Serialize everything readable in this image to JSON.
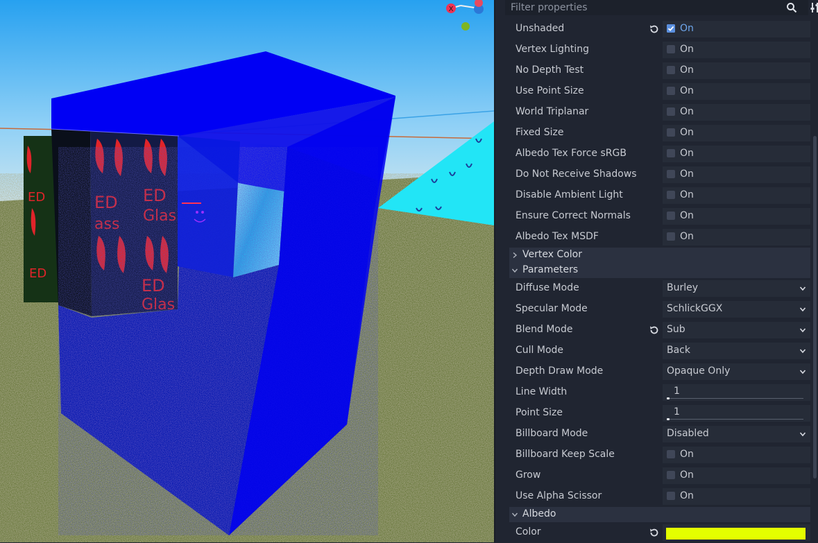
{
  "inspector": {
    "filter_placeholder": "Filter properties",
    "on_label": "On",
    "flags": [
      {
        "name": "Unshaded",
        "checked": true,
        "modified": true
      },
      {
        "name": "Vertex Lighting",
        "checked": false,
        "modified": false
      },
      {
        "name": "No Depth Test",
        "checked": false,
        "modified": false
      },
      {
        "name": "Use Point Size",
        "checked": false,
        "modified": false
      },
      {
        "name": "World Triplanar",
        "checked": false,
        "modified": false
      },
      {
        "name": "Fixed Size",
        "checked": false,
        "modified": false
      },
      {
        "name": "Albedo Tex Force sRGB",
        "checked": false,
        "modified": false
      },
      {
        "name": "Do Not Receive Shadows",
        "checked": false,
        "modified": false
      },
      {
        "name": "Disable Ambient Light",
        "checked": false,
        "modified": false
      },
      {
        "name": "Ensure Correct Normals",
        "checked": false,
        "modified": false
      },
      {
        "name": "Albedo Tex MSDF",
        "checked": false,
        "modified": false
      }
    ],
    "section_vertex_color": "Vertex Color",
    "section_parameters": "Parameters",
    "parameters": {
      "diffuse_mode": {
        "name": "Diffuse Mode",
        "value": "Burley"
      },
      "specular_mode": {
        "name": "Specular Mode",
        "value": "SchlickGGX"
      },
      "blend_mode": {
        "name": "Blend Mode",
        "value": "Sub",
        "modified": true
      },
      "cull_mode": {
        "name": "Cull Mode",
        "value": "Back"
      },
      "depth_draw_mode": {
        "name": "Depth Draw Mode",
        "value": "Opaque Only"
      },
      "line_width": {
        "name": "Line Width",
        "value": "1"
      },
      "point_size": {
        "name": "Point Size",
        "value": "1"
      },
      "billboard_mode": {
        "name": "Billboard Mode",
        "value": "Disabled"
      },
      "billboard_keep_scale": {
        "name": "Billboard Keep Scale",
        "checked": false
      },
      "grow": {
        "name": "Grow",
        "checked": false
      },
      "use_alpha_scissor": {
        "name": "Use Alpha Scissor",
        "checked": false
      }
    },
    "section_albedo": "Albedo",
    "albedo": {
      "color_label": "Color",
      "color_value": "#e4ff00",
      "modified": true
    }
  },
  "viewport": {
    "gizmo_x_label": "X"
  },
  "colors": {
    "panel_bg": "#202531",
    "field_bg": "#262c38",
    "section_bg": "#2b3140",
    "accent": "#6ea6ec",
    "sky": "#4fb0ee",
    "box_blue": "#0000ff"
  }
}
